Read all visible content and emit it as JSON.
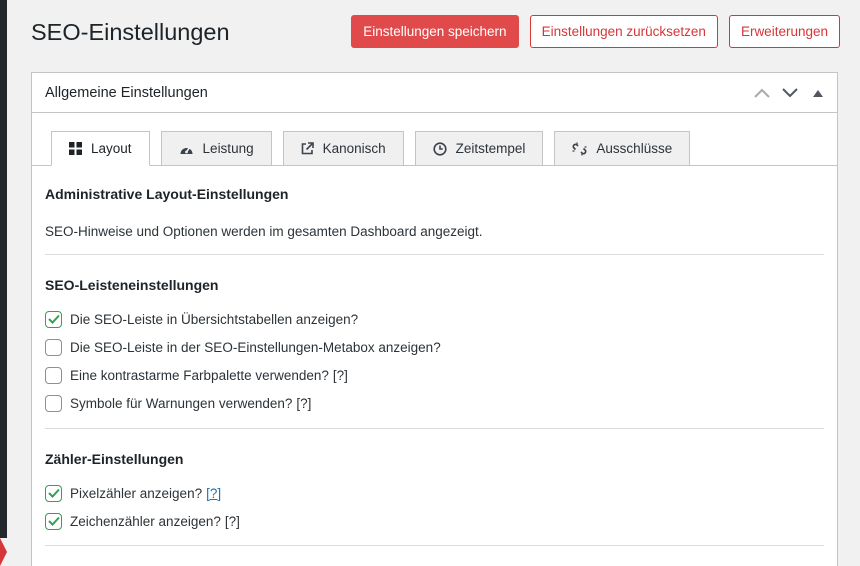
{
  "page": {
    "title": "SEO-Einstellungen"
  },
  "header": {
    "save_label": "Einstellungen speichern",
    "reset_label": "Einstellungen zurücksetzen",
    "extensions_label": "Erweiterungen"
  },
  "panel": {
    "title": "Allgemeine Einstellungen"
  },
  "tabs": [
    {
      "label": "Layout",
      "icon": "grid-icon",
      "active": true
    },
    {
      "label": "Leistung",
      "icon": "dashboard-icon",
      "active": false
    },
    {
      "label": "Kanonisch",
      "icon": "external-link-icon",
      "active": false
    },
    {
      "label": "Zeitstempel",
      "icon": "clock-icon",
      "active": false
    },
    {
      "label": "Ausschlüsse",
      "icon": "broken-link-icon",
      "active": false
    }
  ],
  "layout_section": {
    "title": "Administrative Layout-Einstellungen",
    "description": "SEO-Hinweise und Optionen werden im gesamten Dashboard angezeigt."
  },
  "bar_section": {
    "title": "SEO-Leisteneinstellungen",
    "options": [
      {
        "label": "Die SEO-Leiste in Übersichtstabellen anzeigen?",
        "checked": true
      },
      {
        "label": "Die SEO-Leiste in der SEO-Einstellungen-Metabox anzeigen?",
        "checked": false
      },
      {
        "label": "Eine kontrastarme Farbpalette verwenden?",
        "help": "[?]",
        "checked": false
      },
      {
        "label": "Symbole für Warnungen verwenden?",
        "help": "[?]",
        "checked": false
      }
    ]
  },
  "counter_section": {
    "title": "Zähler-Einstellungen",
    "options": [
      {
        "label": "Pixelzähler anzeigen?",
        "help": "[?]",
        "checked": true
      },
      {
        "label": "Zeichenzähler anzeigen?",
        "help": "[?]",
        "checked": true
      }
    ]
  },
  "colors": {
    "primary": "#e04a4a",
    "accent_red": "#d63638",
    "check_green": "#2ea44f",
    "link_blue": "#2271b1"
  }
}
